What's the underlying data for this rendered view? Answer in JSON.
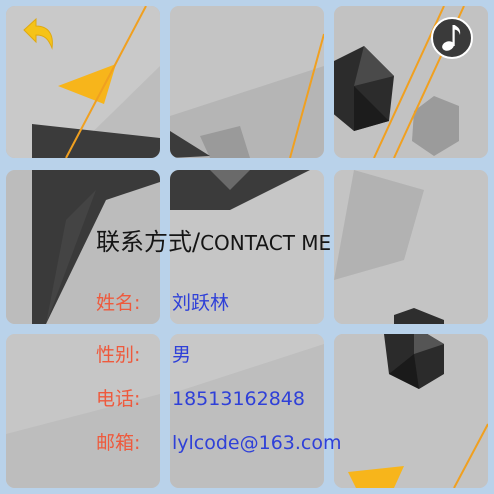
{
  "card": {
    "title_cn": "联系方式/",
    "title_en": "CONTACT ME"
  },
  "fields": [
    {
      "label": "姓名:",
      "value": "刘跃林"
    },
    {
      "label": "性别:",
      "value": "男"
    },
    {
      "label": "电话:",
      "value": "18513162848"
    },
    {
      "label": "邮箱:",
      "value": "lylcode@163.com"
    }
  ],
  "icons": {
    "back": "back-arrow-icon",
    "music": "music-note-icon"
  },
  "colors": {
    "background": "#b9d2ea",
    "label": "#ee5a3d",
    "value": "#2f40d8",
    "accent_orange": "#f7a81a",
    "back_icon": "#f5c318"
  }
}
